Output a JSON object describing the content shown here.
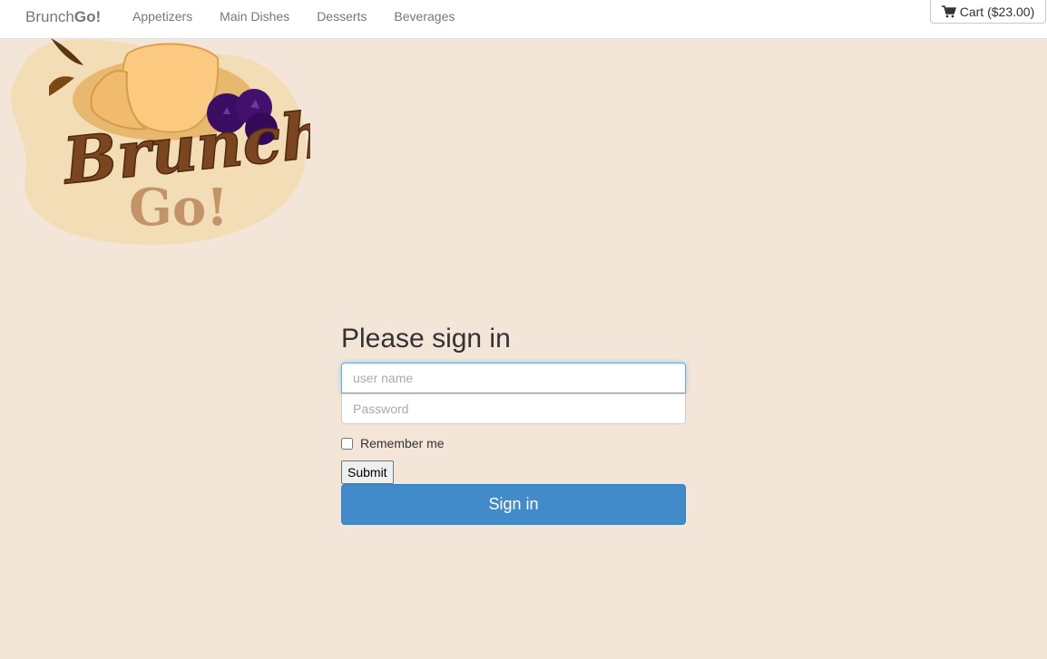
{
  "navbar": {
    "brand_regular": "Brunch",
    "brand_bold": "Go!",
    "links": [
      "Appetizers",
      "Main Dishes",
      "Desserts",
      "Beverages"
    ],
    "cart_label": "Cart ($23.00)"
  },
  "logo": {
    "word1": "Brunch",
    "word2": "Go!"
  },
  "signin": {
    "heading": "Please sign in",
    "username_placeholder": "user name",
    "password_placeholder": "Password",
    "remember_label": "Remember me",
    "submit_label": "Submit",
    "signin_label": "Sign in"
  },
  "colors": {
    "page_bg": "#f3e6d8",
    "primary": "#428bca"
  }
}
